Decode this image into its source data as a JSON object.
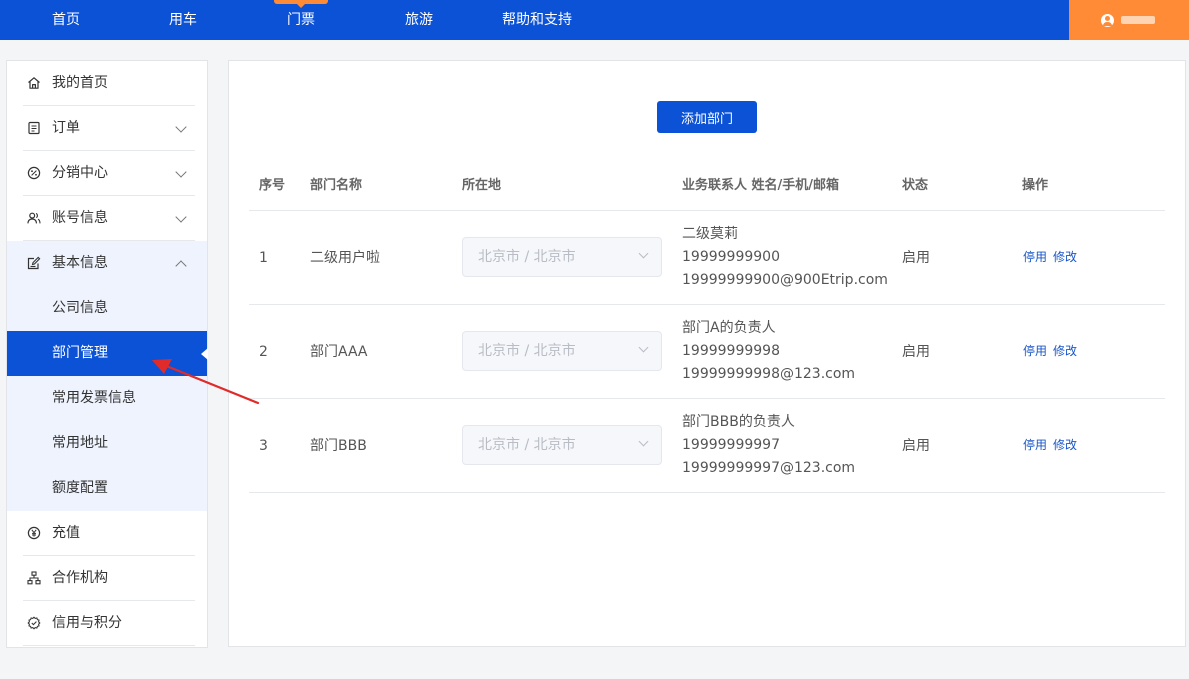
{
  "nav": {
    "items": [
      {
        "label": "首页"
      },
      {
        "label": "用车"
      },
      {
        "label": "门票"
      },
      {
        "label": "旅游"
      },
      {
        "label": "帮助和支持"
      }
    ],
    "active_index": 2
  },
  "sidebar": {
    "items": [
      {
        "label": "我的首页",
        "icon": "home-icon"
      },
      {
        "label": "订单",
        "icon": "order-icon"
      },
      {
        "label": "分销中心",
        "icon": "distribution-icon"
      },
      {
        "label": "账号信息",
        "icon": "user-group-icon"
      },
      {
        "label": "基本信息",
        "icon": "edit-info-icon"
      },
      {
        "label": "充值",
        "icon": "yen-circle-icon"
      },
      {
        "label": "合作机构",
        "icon": "org-chart-icon"
      },
      {
        "label": "信用与积分",
        "icon": "credit-icon"
      }
    ],
    "sub_items": [
      {
        "label": "公司信息"
      },
      {
        "label": "部门管理"
      },
      {
        "label": "常用发票信息"
      },
      {
        "label": "常用地址"
      },
      {
        "label": "额度配置"
      }
    ]
  },
  "main": {
    "add_button": "添加部门",
    "headers": {
      "index": "序号",
      "name": "部门名称",
      "location": "所在地",
      "contact": "业务联系人 姓名/手机/邮箱",
      "status": "状态",
      "actions": "操作"
    },
    "rows": [
      {
        "index": "1",
        "name": "二级用户啦",
        "location": "北京市 / 北京市",
        "contact_name": "二级莫莉",
        "contact_phone": "19999999900",
        "contact_email": "19999999900@900Etrip.com",
        "status": "启用",
        "disable": "停用",
        "edit": "修改"
      },
      {
        "index": "2",
        "name": "部门AAA",
        "location": "北京市 / 北京市",
        "contact_name": "部门A的负责人",
        "contact_phone": "19999999998",
        "contact_email": "19999999998@123.com",
        "status": "启用",
        "disable": "停用",
        "edit": "修改"
      },
      {
        "index": "3",
        "name": "部门BBB",
        "location": "北京市 / 北京市",
        "contact_name": "部门BBB的负责人",
        "contact_phone": "19999999997",
        "contact_email": "19999999997@123.com",
        "status": "启用",
        "disable": "停用",
        "edit": "修改"
      }
    ]
  },
  "colors": {
    "primary": "#0b52d6",
    "accent": "#ff8b37",
    "submenu_bg": "#eef3fd",
    "annotation": "#e02b2b"
  }
}
